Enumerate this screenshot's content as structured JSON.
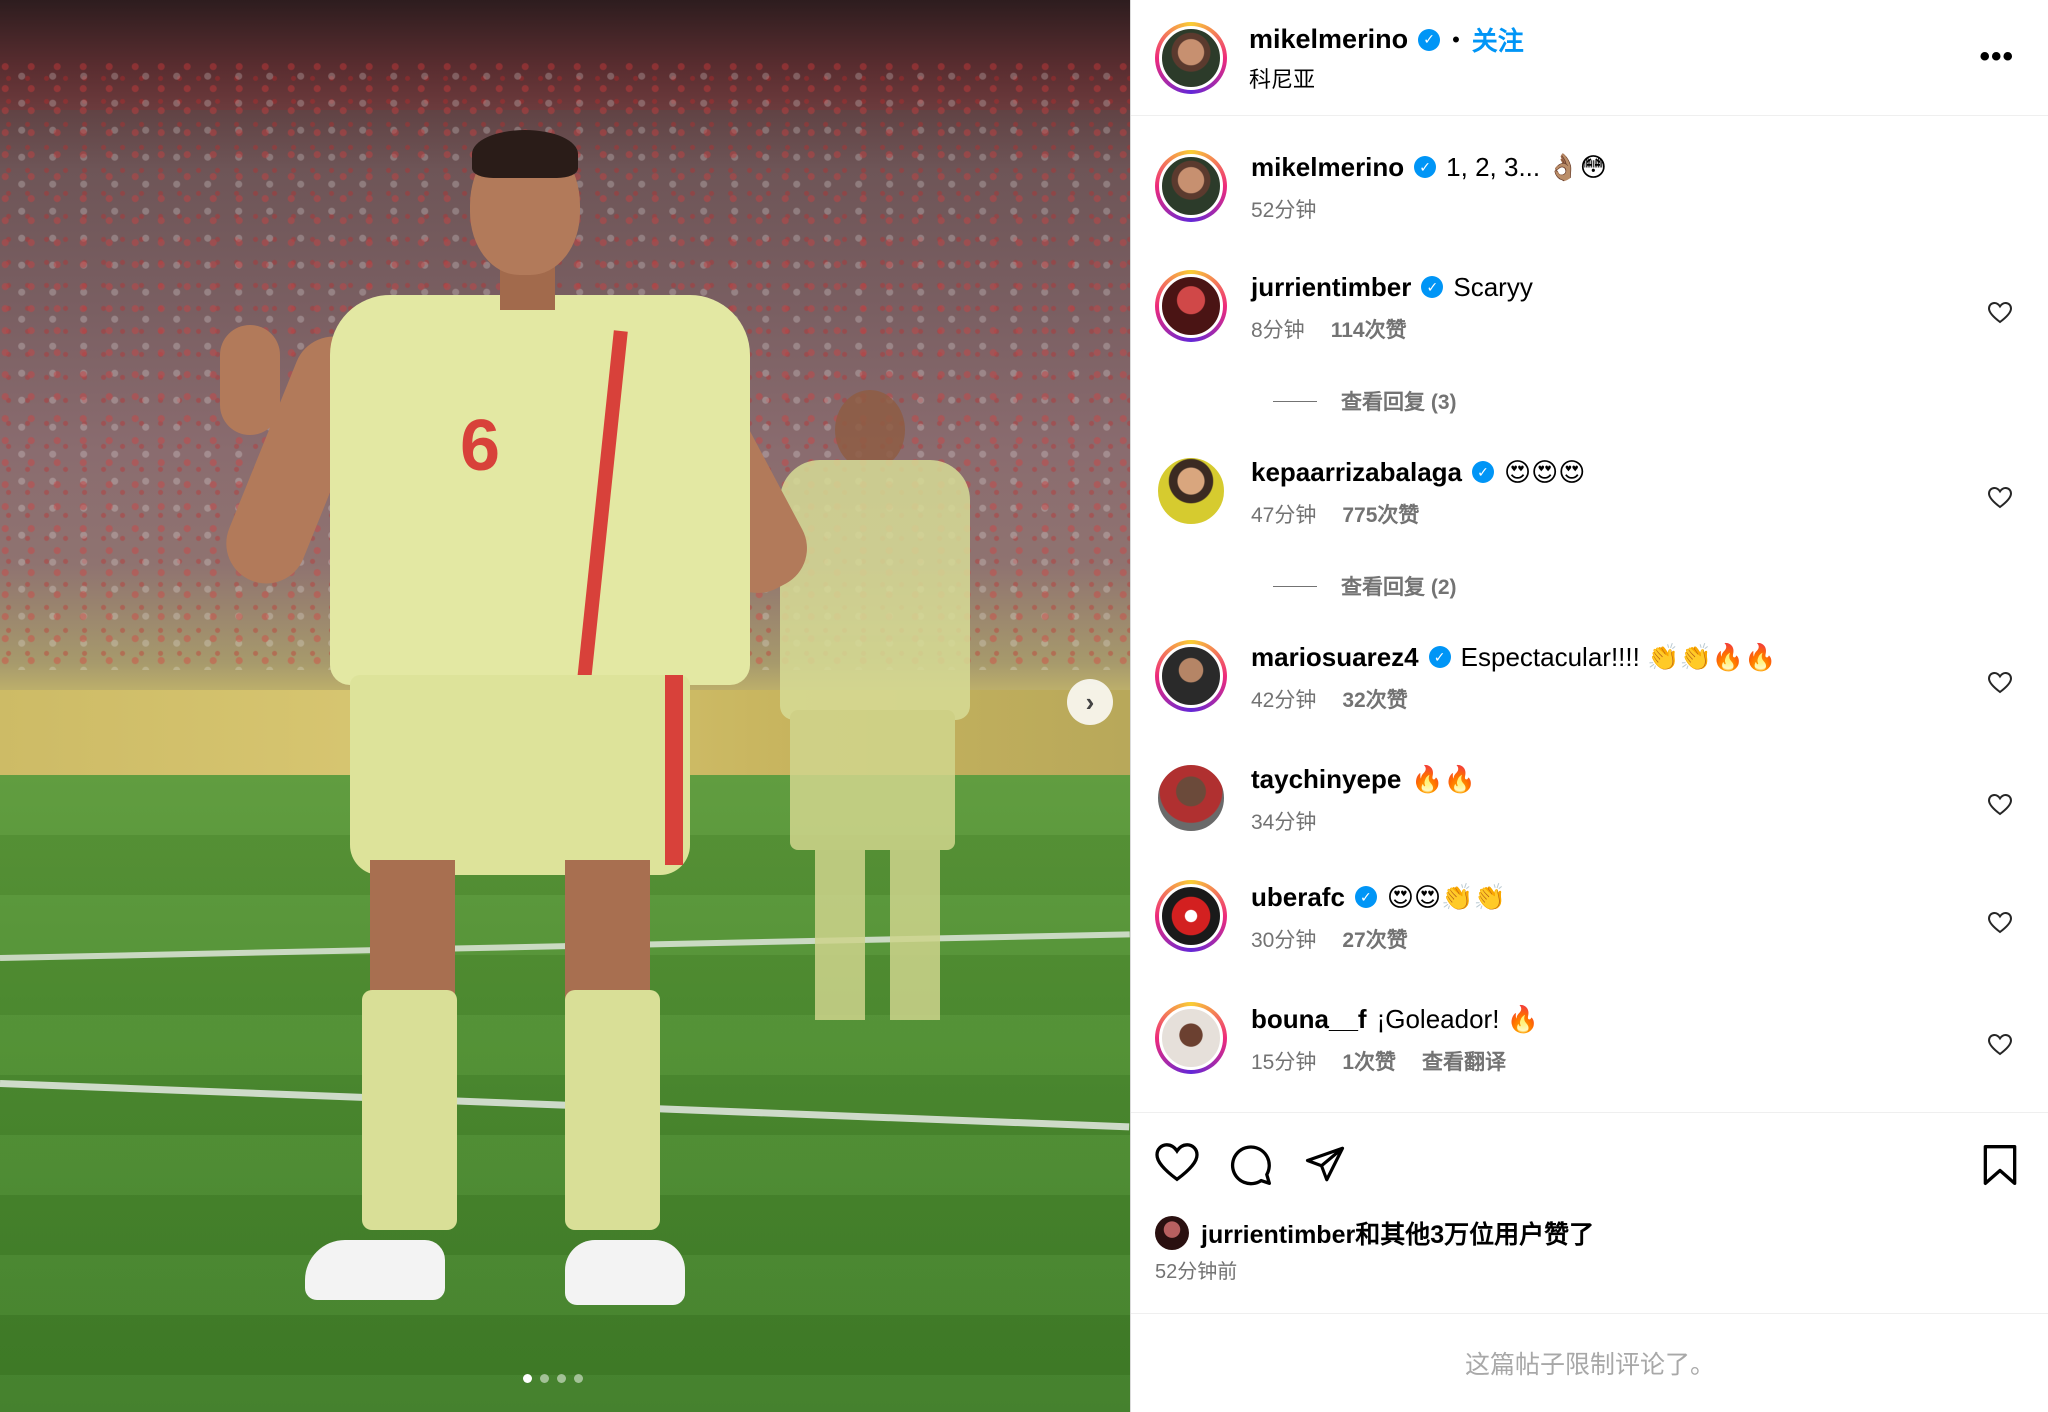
{
  "header": {
    "username": "mikelmerino",
    "separator": "•",
    "follow_label": "关注",
    "location": "科尼亚",
    "more_label": "•••"
  },
  "media": {
    "next_arrow": "›",
    "carousel_count": 4,
    "carousel_active": 1,
    "jersey_number": "6"
  },
  "caption": {
    "username": "mikelmerino",
    "text": "1, 2, 3... 👌🏽😳",
    "time": "52分钟"
  },
  "comments": [
    {
      "username": "jurrientimber",
      "verified": true,
      "text": "Scaryy",
      "time": "8分钟",
      "likes": "114次赞",
      "replies": "查看回复 (3)"
    },
    {
      "username": "kepaarrizabalaga",
      "verified": true,
      "text": "😍😍😍",
      "time": "47分钟",
      "likes": "775次赞",
      "replies": "查看回复 (2)"
    },
    {
      "username": "mariosuarez4",
      "verified": true,
      "text": "Espectacular!!!! 👏👏🔥🔥",
      "time": "42分钟",
      "likes": "32次赞"
    },
    {
      "username": "taychinyepe",
      "verified": false,
      "text": "🔥🔥",
      "time": "34分钟"
    },
    {
      "username": "uberafc",
      "verified": true,
      "text": "😍😍👏👏",
      "time": "30分钟",
      "likes": "27次赞"
    },
    {
      "username": "bouna__f",
      "verified": false,
      "text": "¡Goleador! 🔥",
      "time": "15分钟",
      "likes": "1次赞",
      "translate": "查看翻译"
    }
  ],
  "actions": {
    "like_icon": "heart-outline",
    "comment_icon": "comment-bubble",
    "share_icon": "paper-plane",
    "save_icon": "bookmark"
  },
  "likes_summary": {
    "text": "jurrientimber和其他3万位用户赞了",
    "ago": "52分钟前"
  },
  "footer": {
    "text": "这篇帖子限制评论了。"
  },
  "colors": {
    "accent": "#0095f6",
    "muted": "#737373",
    "border": "#efefef"
  }
}
